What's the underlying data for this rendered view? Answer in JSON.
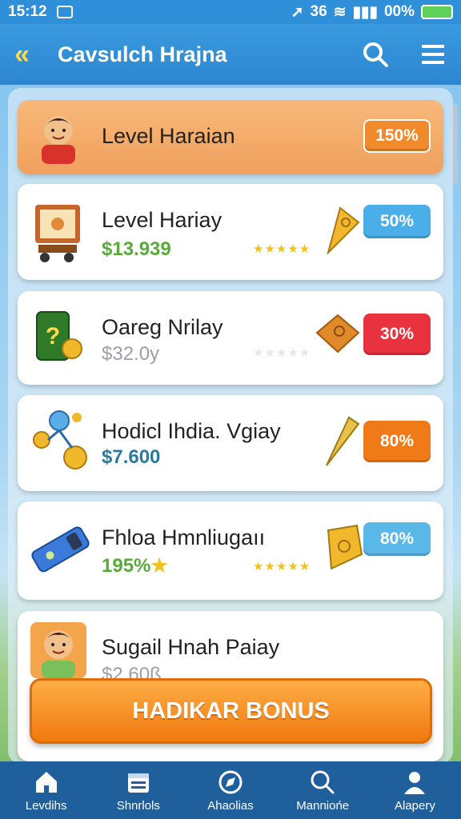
{
  "status_bar": {
    "time": "15:12",
    "signal_text": "36",
    "battery_text": "00%"
  },
  "header": {
    "title": "Cavsulch Hrajna"
  },
  "rows": [
    {
      "title": "Level Haraian",
      "price": "",
      "percent": "150%",
      "badge_color": "#f08a2a",
      "stars": "",
      "featured": true,
      "thumb_icon": "avatar-icon"
    },
    {
      "title": "Level Hariay",
      "price": "$13.939",
      "price_color": "#5aaa3a",
      "percent": "50%",
      "badge_color": "#4aaee8",
      "stars": "★★★★★",
      "thumb_icon": "board-icon"
    },
    {
      "title": "Oareg Nrilay",
      "price": "$32.0y",
      "price_color": "#9aa0a8",
      "percent": "30%",
      "badge_color": "#e8333f",
      "stars": "★★★★★",
      "thumb_icon": "card-icon"
    },
    {
      "title": "Hodicl Ihdia. Vgiay",
      "price": "$7.600",
      "price_color": "#2c7a9a",
      "percent": "80%",
      "badge_color": "#f07a18",
      "stars": "",
      "thumb_icon": "coins-icon"
    },
    {
      "title": "Fhloa Hmnliugaıı",
      "price": "195%",
      "price_color": "#5aaa3a",
      "percent": "80%",
      "badge_color": "#5ab8e8",
      "stars": "★★★★★",
      "thumb_icon": "ticket-icon"
    },
    {
      "title": "Sugail Hnah Paiay",
      "price": "$2.60ß",
      "price_color": "#9aa0a8",
      "percent": "",
      "badge_color": "",
      "stars": "",
      "thumb_icon": "avatar-icon"
    }
  ],
  "bonus_button": {
    "label": "HADIKAR BONUS"
  },
  "nav": [
    {
      "label": "Levdihs",
      "icon": "home-icon"
    },
    {
      "label": "Shnrlols",
      "icon": "calendar-icon"
    },
    {
      "label": "Ahaolias",
      "icon": "compass-icon"
    },
    {
      "label": "Manniońe",
      "icon": "search-icon"
    },
    {
      "label": "Alapery",
      "icon": "profile-icon"
    }
  ]
}
